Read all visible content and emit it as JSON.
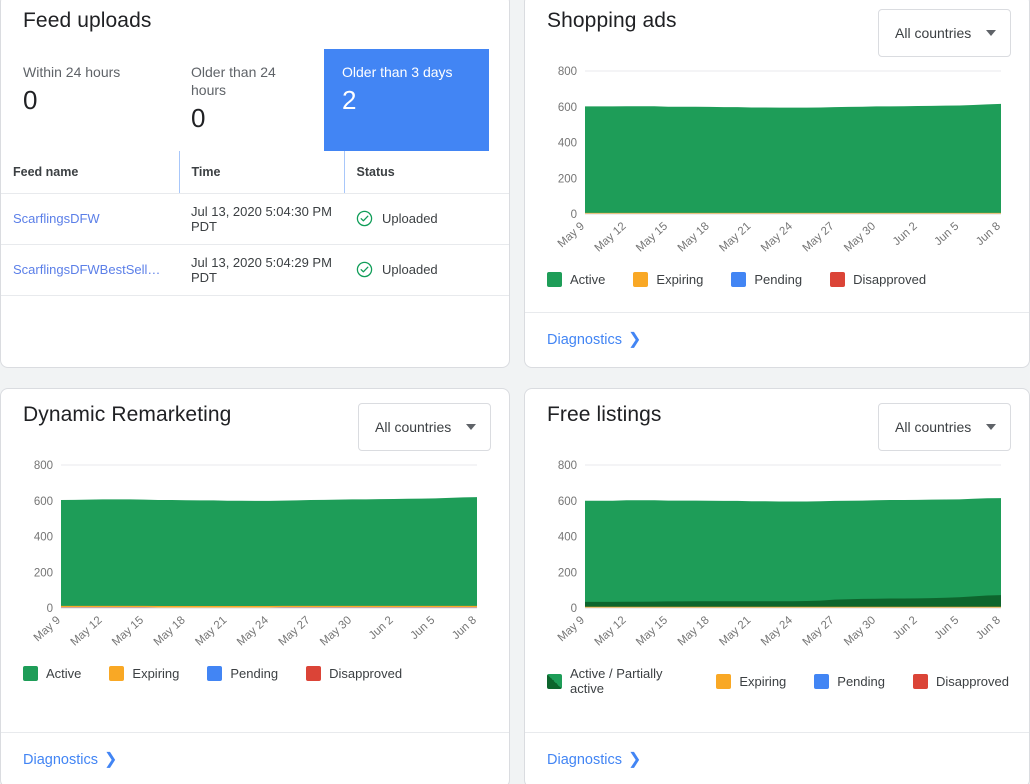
{
  "feed_uploads": {
    "title": "Feed uploads",
    "tiles": [
      {
        "label": "Within 24 hours",
        "value": "0"
      },
      {
        "label": "Older than 24 hours",
        "value": "0"
      },
      {
        "label": "Older than 3 days",
        "value": "2",
        "highlight": true,
        "color": "#4285f4"
      }
    ],
    "columns": [
      "Feed name",
      "Time",
      "Status"
    ],
    "rows": [
      {
        "name": "ScarflingsDFW",
        "time": "Jul 13, 2020 5:04:30 PM PDT",
        "status": "Uploaded",
        "status_icon": "check-circle-icon"
      },
      {
        "name": "ScarflingsDFWBestSell…",
        "time": "Jul 13, 2020 5:04:29 PM PDT",
        "status": "Uploaded",
        "status_icon": "check-circle-icon"
      }
    ]
  },
  "shopping_ads": {
    "title": "Shopping ads",
    "country_filter": "All countries",
    "diagnostics_label": "Diagnostics"
  },
  "dynamic_remarketing": {
    "title": "Dynamic Remarketing",
    "country_filter": "All countries",
    "diagnostics_label": "Diagnostics"
  },
  "free_listings": {
    "title": "Free listings",
    "country_filter": "All countries",
    "diagnostics_label": "Diagnostics"
  },
  "colors": {
    "active": "#1e9d58",
    "partially_active": "#0d652d",
    "expiring": "#f9a825",
    "pending": "#4285f4",
    "disapproved": "#db4437",
    "highlight_blue": "#4285f4",
    "link_blue": "#4285f4"
  },
  "chart_data": [
    {
      "id": "shopping-ads-chart",
      "type": "area",
      "title": "Shopping ads",
      "stacked": true,
      "xlabel": "",
      "ylabel": "",
      "ylim": [
        0,
        800
      ],
      "yticks": [
        0,
        200,
        400,
        600,
        800
      ],
      "grid": "y-top-only",
      "legend_position": "bottom",
      "categories": [
        "May 9",
        "May 12",
        "May 15",
        "May 18",
        "May 21",
        "May 24",
        "May 27",
        "May 30",
        "Jun 2",
        "Jun 5",
        "Jun 8"
      ],
      "x": [
        "May 9",
        "May 10",
        "May 11",
        "May 12",
        "May 13",
        "May 14",
        "May 15",
        "May 16",
        "May 17",
        "May 18",
        "May 19",
        "May 20",
        "May 21",
        "May 22",
        "May 23",
        "May 24",
        "May 25",
        "May 26",
        "May 27",
        "May 28",
        "May 29",
        "May 30",
        "May 31",
        "Jun 1",
        "Jun 2",
        "Jun 3",
        "Jun 4",
        "Jun 5",
        "Jun 6",
        "Jun 7",
        "Jun 8"
      ],
      "series": [
        {
          "name": "Active",
          "color": "#1e9d58",
          "values": [
            596,
            596,
            596,
            597,
            597,
            597,
            594,
            594,
            594,
            593,
            592,
            592,
            590,
            590,
            589,
            589,
            589,
            590,
            592,
            593,
            594,
            596,
            596,
            597,
            598,
            599,
            600,
            601,
            604,
            607,
            610
          ]
        },
        {
          "name": "Expiring",
          "color": "#f9a825",
          "values": [
            5,
            5,
            5,
            5,
            5,
            5,
            5,
            5,
            5,
            5,
            5,
            5,
            5,
            5,
            5,
            5,
            5,
            5,
            5,
            5,
            5,
            5,
            5,
            5,
            5,
            5,
            5,
            5,
            5,
            5,
            5
          ]
        },
        {
          "name": "Pending",
          "color": "#4285f4",
          "values": [
            0,
            0,
            0,
            0,
            0,
            0,
            0,
            0,
            0,
            0,
            0,
            0,
            0,
            0,
            0,
            0,
            0,
            0,
            0,
            0,
            0,
            0,
            0,
            0,
            0,
            0,
            0,
            0,
            0,
            0,
            0
          ]
        },
        {
          "name": "Disapproved",
          "color": "#db4437",
          "values": [
            1,
            1,
            1,
            1,
            1,
            1,
            1,
            1,
            1,
            1,
            1,
            1,
            1,
            1,
            1,
            1,
            1,
            1,
            1,
            1,
            1,
            1,
            1,
            1,
            1,
            1,
            1,
            1,
            1,
            1,
            1
          ]
        }
      ]
    },
    {
      "id": "dynamic-remarketing-chart",
      "type": "area",
      "title": "Dynamic Remarketing",
      "stacked": true,
      "ylim": [
        0,
        800
      ],
      "yticks": [
        0,
        200,
        400,
        600,
        800
      ],
      "grid": "y-top-only",
      "legend_position": "bottom",
      "categories": [
        "May 9",
        "May 12",
        "May 15",
        "May 18",
        "May 21",
        "May 24",
        "May 27",
        "May 30",
        "Jun 2",
        "Jun 5",
        "Jun 8"
      ],
      "x": [
        "May 9",
        "May 10",
        "May 11",
        "May 12",
        "May 13",
        "May 14",
        "May 15",
        "May 16",
        "May 17",
        "May 18",
        "May 19",
        "May 20",
        "May 21",
        "May 22",
        "May 23",
        "May 24",
        "May 25",
        "May 26",
        "May 27",
        "May 28",
        "May 29",
        "May 30",
        "May 31",
        "Jun 1",
        "Jun 2",
        "Jun 3",
        "Jun 4",
        "Jun 5",
        "Jun 6",
        "Jun 7",
        "Jun 8"
      ],
      "series": [
        {
          "name": "Active",
          "color": "#1e9d58",
          "values": [
            592,
            593,
            594,
            596,
            596,
            596,
            594,
            593,
            593,
            592,
            591,
            591,
            589,
            589,
            588,
            588,
            589,
            590,
            592,
            593,
            594,
            596,
            596,
            597,
            598,
            599,
            600,
            601,
            604,
            607,
            608
          ]
        },
        {
          "name": "Expiring",
          "color": "#f9a825",
          "values": [
            8,
            8,
            8,
            8,
            8,
            8,
            8,
            8,
            8,
            8,
            8,
            8,
            8,
            8,
            8,
            8,
            8,
            8,
            8,
            8,
            8,
            8,
            8,
            8,
            8,
            8,
            8,
            8,
            8,
            8,
            8
          ]
        },
        {
          "name": "Pending",
          "color": "#4285f4",
          "values": [
            0,
            0,
            0,
            0,
            0,
            0,
            0,
            0,
            0,
            0,
            0,
            0,
            0,
            0,
            0,
            0,
            0,
            0,
            0,
            0,
            0,
            0,
            0,
            0,
            0,
            0,
            0,
            0,
            0,
            0,
            0
          ]
        },
        {
          "name": "Disapproved",
          "color": "#db4437",
          "values": [
            4,
            4,
            4,
            4,
            4,
            4,
            4,
            3,
            3,
            3,
            3,
            3,
            3,
            3,
            3,
            3,
            4,
            4,
            4,
            4,
            4,
            4,
            4,
            4,
            4,
            4,
            4,
            4,
            4,
            4,
            4
          ]
        }
      ]
    },
    {
      "id": "free-listings-chart",
      "type": "area",
      "title": "Free listings",
      "stacked": true,
      "ylim": [
        0,
        800
      ],
      "yticks": [
        0,
        200,
        400,
        600,
        800
      ],
      "grid": "y-top-only",
      "legend_position": "bottom",
      "categories": [
        "May 9",
        "May 12",
        "May 15",
        "May 18",
        "May 21",
        "May 24",
        "May 27",
        "May 30",
        "Jun 2",
        "Jun 5",
        "Jun 8"
      ],
      "x": [
        "May 9",
        "May 10",
        "May 11",
        "May 12",
        "May 13",
        "May 14",
        "May 15",
        "May 16",
        "May 17",
        "May 18",
        "May 19",
        "May 20",
        "May 21",
        "May 22",
        "May 23",
        "May 24",
        "May 25",
        "May 26",
        "May 27",
        "May 28",
        "May 29",
        "May 30",
        "May 31",
        "Jun 1",
        "Jun 2",
        "Jun 3",
        "Jun 4",
        "Jun 5",
        "Jun 6",
        "Jun 7",
        "Jun 8"
      ],
      "series": [
        {
          "name": "Active",
          "color": "#1e9d58",
          "values": [
            566,
            566,
            566,
            568,
            568,
            567,
            564,
            564,
            563,
            562,
            561,
            561,
            559,
            559,
            558,
            558,
            557,
            556,
            552,
            551,
            550,
            551,
            551,
            551,
            551,
            551,
            550,
            548,
            546,
            544,
            543
          ]
        },
        {
          "name": "Partially active",
          "color": "#0d652d",
          "values": [
            27,
            27,
            27,
            28,
            28,
            29,
            30,
            30,
            31,
            31,
            31,
            31,
            31,
            31,
            31,
            31,
            32,
            34,
            40,
            42,
            44,
            45,
            46,
            46,
            47,
            48,
            50,
            53,
            58,
            63,
            65
          ]
        },
        {
          "name": "Expiring",
          "color": "#f9a825",
          "values": [
            6,
            6,
            6,
            6,
            6,
            6,
            6,
            6,
            6,
            6,
            6,
            6,
            6,
            6,
            6,
            6,
            6,
            6,
            6,
            6,
            6,
            6,
            6,
            6,
            6,
            6,
            6,
            6,
            6,
            6,
            6
          ]
        },
        {
          "name": "Pending",
          "color": "#4285f4",
          "values": [
            0,
            0,
            0,
            0,
            0,
            0,
            0,
            0,
            0,
            0,
            0,
            0,
            0,
            0,
            0,
            0,
            0,
            0,
            0,
            0,
            0,
            0,
            0,
            0,
            0,
            0,
            0,
            0,
            0,
            0,
            0
          ]
        },
        {
          "name": "Disapproved",
          "color": "#db4437",
          "values": [
            1,
            1,
            1,
            1,
            1,
            1,
            1,
            1,
            1,
            1,
            1,
            1,
            1,
            1,
            1,
            1,
            1,
            1,
            1,
            1,
            1,
            1,
            1,
            1,
            1,
            1,
            1,
            1,
            1,
            1,
            1
          ]
        }
      ]
    }
  ],
  "legends": {
    "standard": [
      {
        "label": "Active",
        "color": "#1e9d58",
        "swatch": "solid"
      },
      {
        "label": "Expiring",
        "color": "#f9a825",
        "swatch": "solid"
      },
      {
        "label": "Pending",
        "color": "#4285f4",
        "swatch": "solid"
      },
      {
        "label": "Disapproved",
        "color": "#db4437",
        "swatch": "solid"
      }
    ],
    "free_listings": [
      {
        "label": "Active / Partially active",
        "color": "#1e9d58",
        "color2": "#0d652d",
        "swatch": "split"
      },
      {
        "label": "Expiring",
        "color": "#f9a825",
        "swatch": "solid"
      },
      {
        "label": "Pending",
        "color": "#4285f4",
        "swatch": "solid"
      },
      {
        "label": "Disapproved",
        "color": "#db4437",
        "swatch": "solid"
      }
    ]
  }
}
